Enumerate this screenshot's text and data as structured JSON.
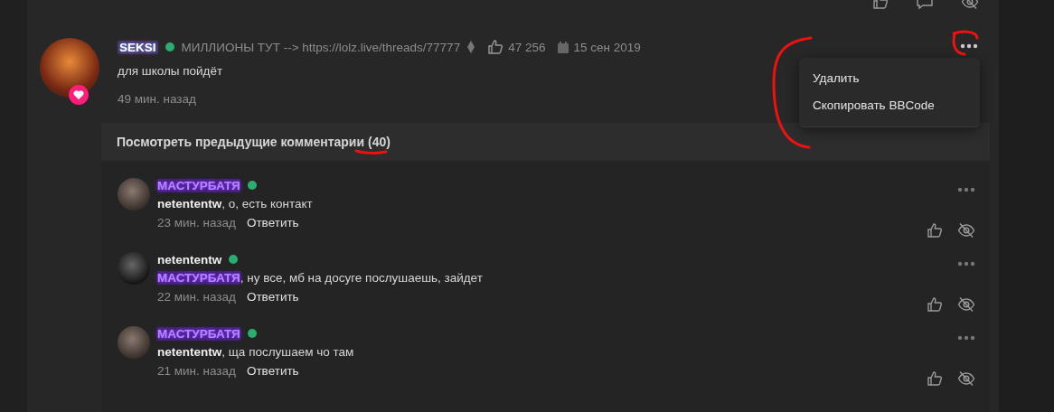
{
  "post": {
    "author": "SEKSI",
    "online": true,
    "status": "МИЛЛИОНЫ ТУТ --> https://lolz.live/threads/77777",
    "likes": "47 256",
    "date": "15 сен 2019",
    "text": "для школы пойдёт",
    "time": "49 мин. назад",
    "menu": {
      "open": true,
      "items": [
        "Удалить",
        "Скопировать BBCode"
      ]
    }
  },
  "previous_comments": {
    "label": "Посмотреть предыдущие комментарии",
    "count": "(40)"
  },
  "comments": [
    {
      "author": "МАСТУРБАТЯ",
      "author_highlighted": true,
      "online": true,
      "mention": "netententw",
      "mention_highlighted": false,
      "text": ", о, есть контакт",
      "time": "23 мин. назад",
      "reply": "Ответить"
    },
    {
      "author": "netententw",
      "author_highlighted": false,
      "online": true,
      "mention": "МАСТУРБАТЯ",
      "mention_highlighted": true,
      "text": ", ну все, мб на досуге послушаешь, зайдет",
      "time": "22 мин. назад",
      "reply": "Ответить"
    },
    {
      "author": "МАСТУРБАТЯ",
      "author_highlighted": true,
      "online": true,
      "mention": "netententw",
      "mention_highlighted": false,
      "text": ", ща послушаем чо там",
      "time": "21 мин. назад",
      "reply": "Ответить"
    }
  ]
}
